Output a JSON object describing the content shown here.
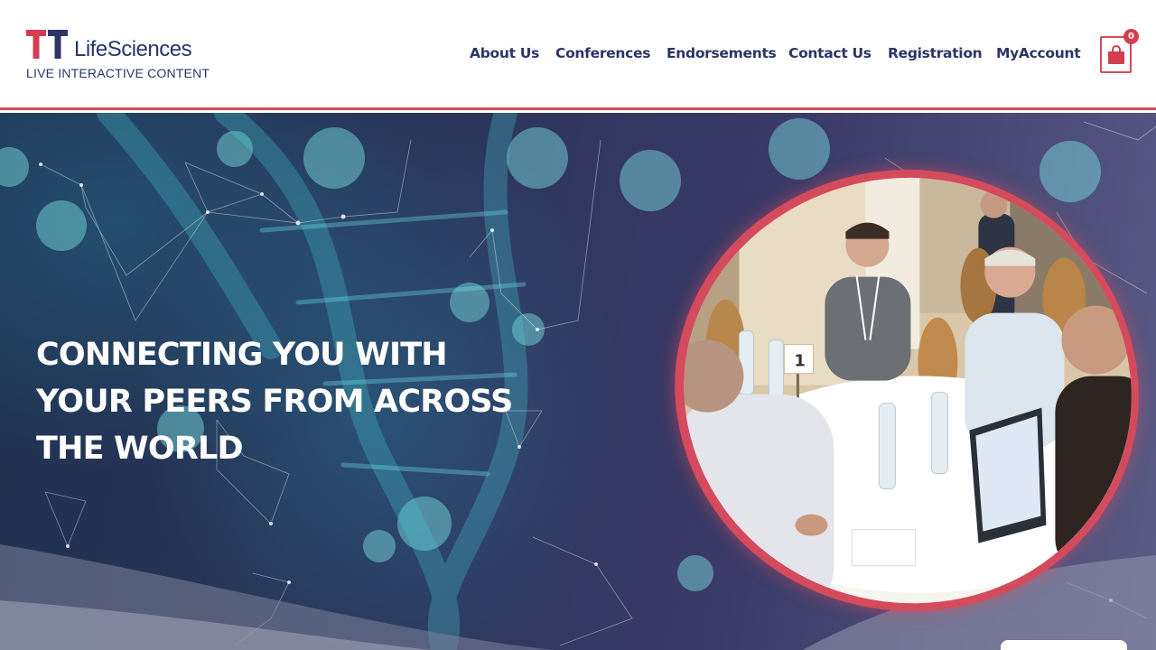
{
  "brand": {
    "logo_mark": "TT",
    "name": "LifeSciences",
    "tagline": "LIVE INTERACTIVE CONTENT",
    "accent_color": "#d43d4e",
    "text_color": "#2b3566"
  },
  "nav": {
    "items": [
      {
        "label": "About Us"
      },
      {
        "label": "Conferences"
      },
      {
        "label": "Endorsements"
      },
      {
        "label": "Contact Us"
      },
      {
        "label": "Registration"
      },
      {
        "label": "MyAccount"
      }
    ]
  },
  "cart": {
    "icon": "shopping-bag-icon",
    "count": "0"
  },
  "hero": {
    "headline": "CONNECTING YOU WITH YOUR PEERS FROM ACROSS THE WORLD",
    "image": "conference-roundtable-photo"
  }
}
